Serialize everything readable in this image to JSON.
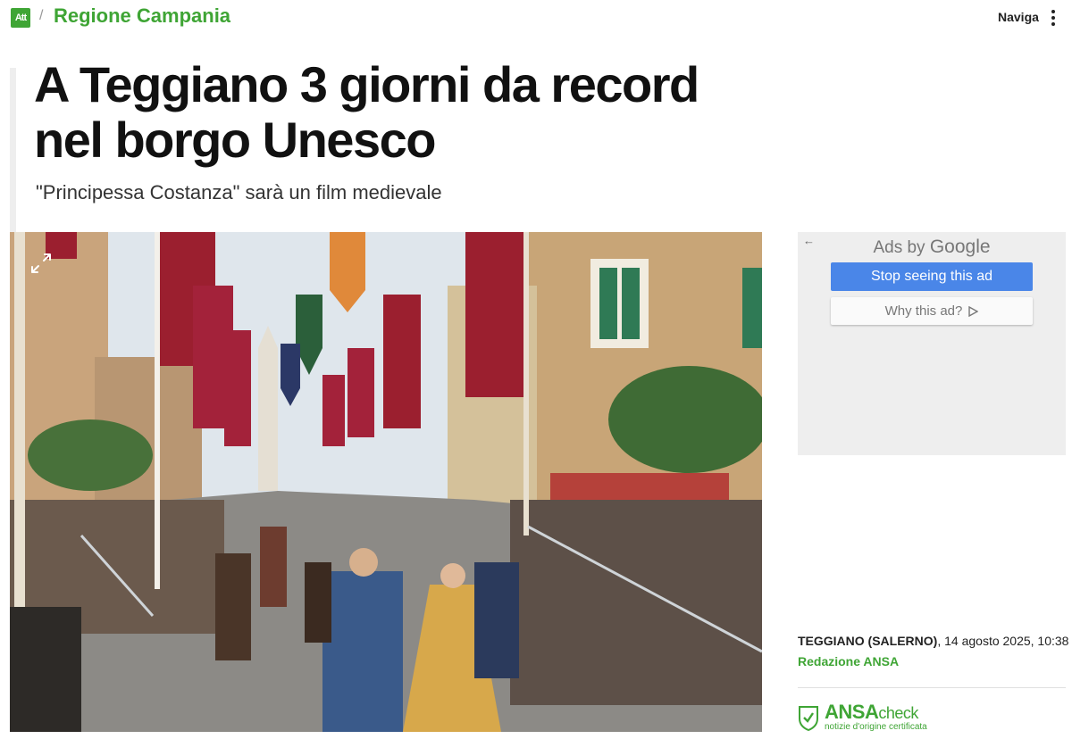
{
  "header": {
    "logo_text": "Att",
    "separator": "/",
    "region": "Regione Campania",
    "nav_label": "Naviga"
  },
  "article": {
    "title": "A Teggiano 3 giorni da record nel borgo Unesco",
    "subtitle": "\"Principessa Costanza\" sarà un film medievale",
    "location": "TEGGIANO (SALERNO)",
    "date": ", 14 agosto 2025, 10:38",
    "author": "Redazione ANSA"
  },
  "ad": {
    "ads_by_prefix": "Ads by ",
    "ads_by_brand": "Google",
    "stop_label": "Stop seeing this ad",
    "why_label": "Why this ad?"
  },
  "ansa_check": {
    "brand": "ANSA",
    "suffix": "check",
    "tagline": "notizie d'origine certificata"
  },
  "colors": {
    "brand_green": "#3fa535",
    "ad_blue": "#4a86e8",
    "ad_bg": "#eeeeee"
  },
  "icons": [
    "kebab-menu-icon",
    "expand-icon",
    "back-arrow-icon",
    "adchoices-icon",
    "shield-check-icon"
  ]
}
